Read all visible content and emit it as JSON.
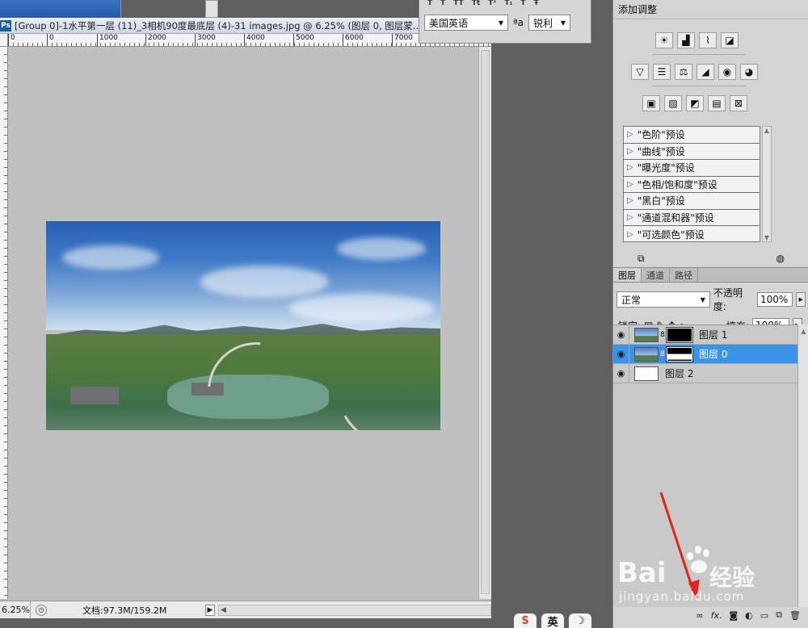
{
  "document": {
    "title": "[Group 0]-1水平第一层 (11)_3相机90度最底层 (4)-31 images.jpg @ 6.25% (图层 0, 图层蒙...",
    "ps_badge": "Ps",
    "ruler_ticks": [
      "0",
      "0",
      "1000",
      "2000",
      "3000",
      "4000",
      "5000",
      "6000",
      "7000"
    ],
    "zoom": "6.25%",
    "doc_size": "文档:97.3M/159.2M"
  },
  "character": {
    "language": "美国英语",
    "aa_label": "ªa",
    "antialias": "锐利"
  },
  "adjustments": {
    "title": "添加调整",
    "presets": [
      "\"色阶\"预设",
      "\"曲线\"预设",
      "\"曝光度\"预设",
      "\"色相/饱和度\"预设",
      "\"黑白\"预设",
      "\"通道混和器\"预设",
      "\"可选颜色\"预设"
    ]
  },
  "layers": {
    "tabs": [
      "图层",
      "通道",
      "路径"
    ],
    "blend_mode": "正常",
    "opacity_label": "不透明度:",
    "opacity": "100%",
    "lock_label": "锁定:",
    "fill_label": "填充:",
    "fill": "100%",
    "items": [
      {
        "name": "图层 1",
        "selected": false,
        "mask": true
      },
      {
        "name": "图层 0",
        "selected": true,
        "mask": true
      },
      {
        "name": "图层 2",
        "selected": false,
        "mask": false
      }
    ],
    "footer_icons": [
      "link-icon",
      "fx-icon",
      "add-mask-icon",
      "adjustment-icon",
      "group-icon",
      "new-layer-icon",
      "delete-icon"
    ]
  },
  "watermark": {
    "brand": "Bai",
    "brand_suffix": "经验",
    "url": "jingyan.baidu.com"
  },
  "tray": [
    "S",
    "英",
    "☽"
  ],
  "colors": {
    "selection": "#3a93e8",
    "arrow": "#e0241b"
  }
}
